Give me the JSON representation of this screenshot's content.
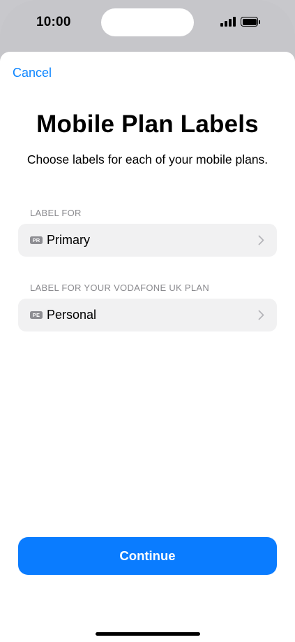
{
  "status_bar": {
    "time": "10:00",
    "icons": [
      "cellular-signal-icon",
      "battery-icon"
    ]
  },
  "sheet": {
    "cancel_label": "Cancel",
    "title": "Mobile Plan Labels",
    "subtitle": "Choose labels for each of your mobile plans.",
    "sections": [
      {
        "header": "LABEL FOR",
        "badge": "PR",
        "value": "Primary"
      },
      {
        "header": "LABEL FOR YOUR VODAFONE UK PLAN",
        "badge": "PE",
        "value": "Personal"
      }
    ],
    "continue_label": "Continue"
  },
  "colors": {
    "accent": "#0a84ff",
    "button": "#0a7cff",
    "row_background": "#f1f1f2",
    "badge": "#8e8e93"
  }
}
